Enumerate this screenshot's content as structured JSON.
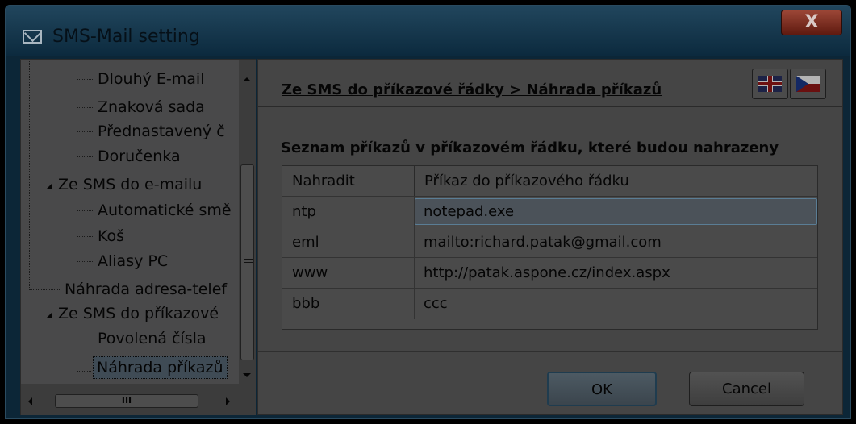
{
  "window": {
    "title": "SMS-Mail setting",
    "close_label": "X"
  },
  "tree": {
    "items": [
      {
        "label": "Dlouhý E-mail",
        "level": 2
      },
      {
        "label": "Znaková sada",
        "level": 2
      },
      {
        "label": "Přednastavený č",
        "level": 2
      },
      {
        "label": "Doručenka",
        "level": 2
      },
      {
        "label": "Ze SMS do e-mailu",
        "level": 1,
        "expanded": true
      },
      {
        "label": "Automatické smě",
        "level": 2
      },
      {
        "label": "Koš",
        "level": 2
      },
      {
        "label": "Aliasy PC",
        "level": 2
      },
      {
        "label": "Náhrada adresa-telef",
        "level": 1
      },
      {
        "label": "Ze SMS do příkazové",
        "level": 1,
        "expanded": true
      },
      {
        "label": "Povolená čísla",
        "level": 2
      },
      {
        "label": "Náhrada příkazů",
        "level": 2,
        "selected": true
      }
    ],
    "hscroll_grip": "III"
  },
  "content": {
    "breadcrumb": "Ze SMS do příkazové řádky  >  Náhrada příkazů",
    "section_title": "Seznam příkazů v příkazovém řádku, které budou nahrazeny",
    "table": {
      "headers": [
        "Nahradit",
        "Příkaz do příkazového řádku"
      ],
      "rows": [
        [
          "ntp",
          "notepad.exe"
        ],
        [
          "eml",
          "mailto:richard.patak@gmail.com"
        ],
        [
          "www",
          "http://patak.aspone.cz/index.aspx"
        ],
        [
          "bbb",
          "ccc"
        ]
      ]
    },
    "ok_label": "OK",
    "cancel_label": "Cancel"
  }
}
